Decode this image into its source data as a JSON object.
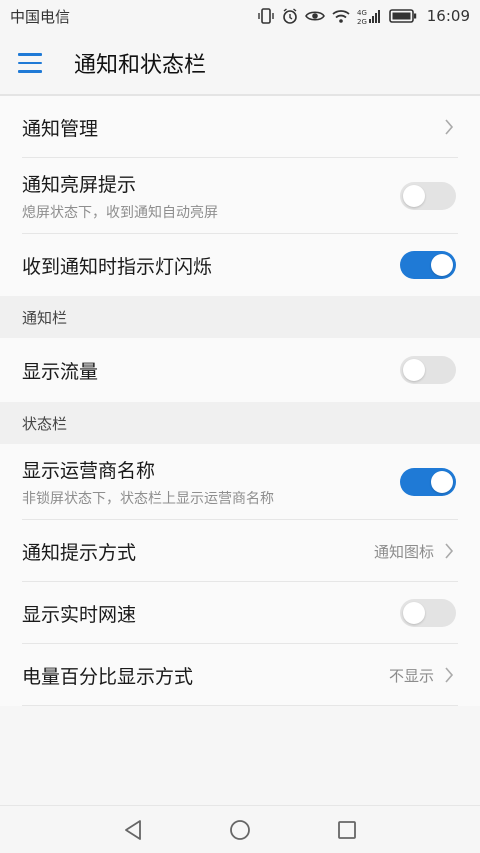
{
  "status_bar": {
    "carrier": "中国电信",
    "network": "4G 2G",
    "time": "16:09"
  },
  "header": {
    "title": "通知和状态栏"
  },
  "accent_color": "#1f7ad6",
  "group1": {
    "notification_management": "通知管理",
    "wake_screen_title": "通知亮屏提示",
    "wake_screen_sub": "熄屏状态下，收到通知自动亮屏",
    "wake_screen_enabled": false,
    "led_blink_title": "收到通知时指示灯闪烁",
    "led_blink_enabled": true
  },
  "notification_bar": {
    "section_title": "通知栏",
    "show_traffic_title": "显示流量",
    "show_traffic_enabled": false
  },
  "status_bar_section": {
    "section_title": "状态栏",
    "carrier_name_title": "显示运营商名称",
    "carrier_name_sub": "非锁屏状态下，状态栏上显示运营商名称",
    "carrier_name_enabled": true,
    "notify_style_title": "通知提示方式",
    "notify_style_value": "通知图标",
    "realtime_speed_title": "显示实时网速",
    "realtime_speed_enabled": false,
    "battery_percent_title": "电量百分比显示方式",
    "battery_percent_value": "不显示"
  },
  "nav_icons": [
    "back-icon",
    "home-icon",
    "recents-icon"
  ]
}
